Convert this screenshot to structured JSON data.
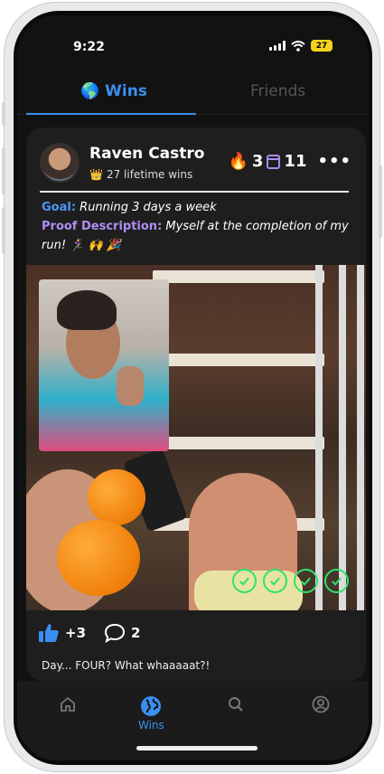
{
  "status_bar": {
    "time": "9:22",
    "battery": "27"
  },
  "tabs": [
    {
      "label": "Wins",
      "icon": "globe-emoji",
      "active": true
    },
    {
      "label": "Friends",
      "active": false
    }
  ],
  "post": {
    "user_name": "Raven Castro",
    "lifetime_icon": "👑",
    "lifetime_wins": "27 lifetime wins",
    "streak_icon": "🔥",
    "streak": "3",
    "calendar_count": "11",
    "goal_label": "Goal:",
    "goal_text": " Running 3 days a week",
    "proof_label": "Proof Description:",
    "proof_text": " Myself at the completion of my run! 🏃‍♀️ 🙌 🎉",
    "likes": "+3",
    "comments": "2",
    "caption": "Day... FOUR? What whaaaaat?!",
    "checks_completed": 4
  },
  "bottom_nav": {
    "items": [
      {
        "label": "",
        "icon": "home-icon"
      },
      {
        "label": "Wins",
        "icon": "globe-icon",
        "active": true
      },
      {
        "label": "",
        "icon": "search-icon"
      },
      {
        "label": "",
        "icon": "profile-icon"
      }
    ]
  },
  "colors": {
    "accent": "#3a8ff0",
    "proof": "#b08df2",
    "check": "#2ee36b"
  }
}
